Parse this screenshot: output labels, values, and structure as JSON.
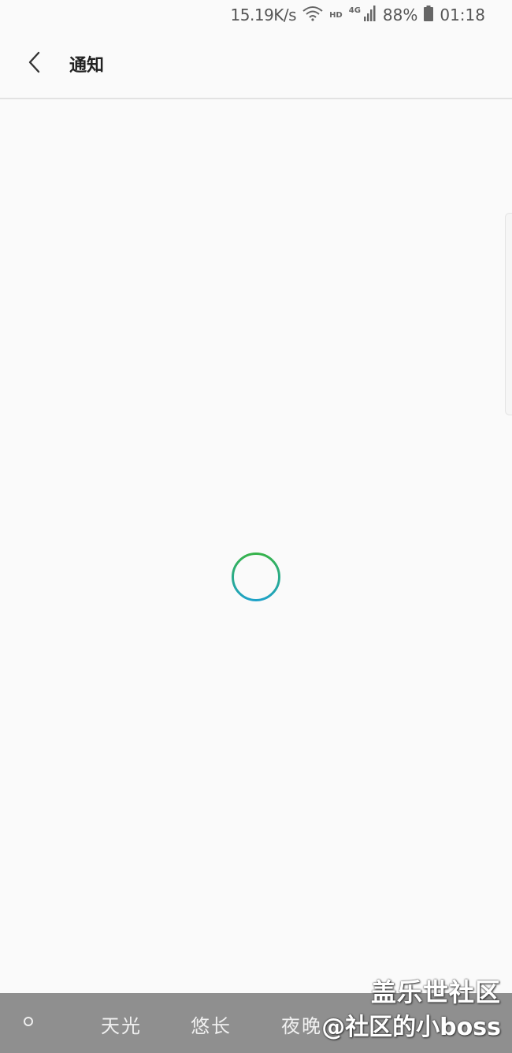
{
  "status_bar": {
    "net_speed": "15.19K/s",
    "hd_label": "HD",
    "network_label": "4G",
    "battery": "88%",
    "time": "01:18",
    "icons": [
      "wifi-icon",
      "signal-icon",
      "battery-icon"
    ]
  },
  "header": {
    "back_icon": "chevron-left-icon",
    "title": "通知"
  },
  "loading": {
    "spinner_colors": [
      "#36b34a",
      "#1ea2c8"
    ]
  },
  "bottom_bar": {
    "tabs": [
      "天光",
      "悠长",
      "夜晚"
    ]
  },
  "watermark": {
    "line1": "盖乐世社区",
    "line2": "@社区的小boss"
  }
}
